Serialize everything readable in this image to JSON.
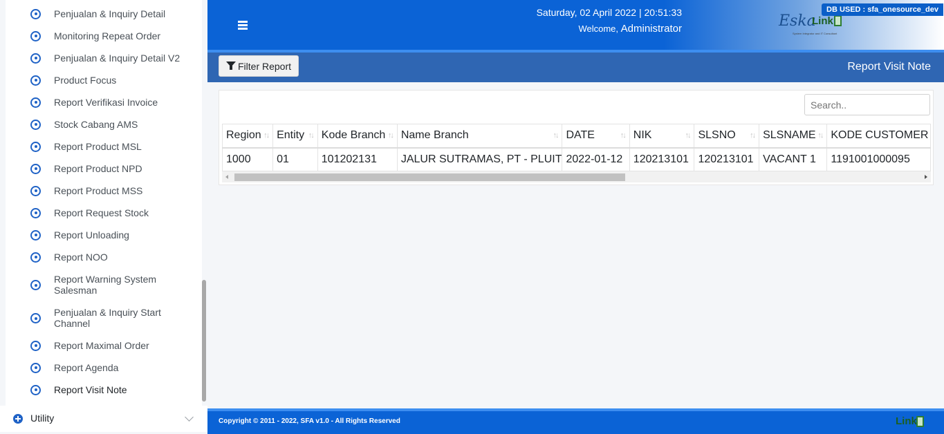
{
  "sidebar": {
    "items": [
      {
        "label": "Penjualan & Inquiry Detail"
      },
      {
        "label": "Monitoring Repeat Order"
      },
      {
        "label": "Penjualan & Inquiry Detail V2"
      },
      {
        "label": "Product Focus"
      },
      {
        "label": "Report Verifikasi Invoice"
      },
      {
        "label": "Stock Cabang AMS"
      },
      {
        "label": "Report Product MSL"
      },
      {
        "label": "Report Product NPD"
      },
      {
        "label": "Report Product MSS"
      },
      {
        "label": "Report Request Stock"
      },
      {
        "label": "Report Unloading"
      },
      {
        "label": "Report NOO"
      },
      {
        "label": "Report Warning System Salesman"
      },
      {
        "label": "Penjualan & Inquiry Start Channel"
      },
      {
        "label": "Report Maximal Order"
      },
      {
        "label": "Report Agenda"
      },
      {
        "label": "Report Visit Note",
        "active": true
      }
    ],
    "utility_label": "Utility"
  },
  "header": {
    "datetime": "Saturday, 02 April 2022 | 20:51:33",
    "welcome_prefix": "Welcome,",
    "username": "Administrator",
    "db_badge": "DB USED : sfa_onesource_dev",
    "logo_eska": "Eska",
    "logo_link": "Link",
    "logo_tagline": "System Integrator and IT Consultant"
  },
  "toolbar": {
    "filter_label": "Filter Report",
    "title": "Report Visit Note"
  },
  "search": {
    "placeholder": "Search.."
  },
  "table": {
    "columns": [
      "Region",
      "Entity",
      "Kode Branch",
      "Name Branch",
      "DATE",
      "NIK",
      "SLSNO",
      "SLSNAME",
      "KODE CUSTOMER"
    ],
    "rows": [
      [
        "1000",
        "01",
        "101202131",
        "JALUR SUTRAMAS, PT - PLUIT",
        "2022-01-12",
        "120213101",
        "120213101",
        "VACANT 1",
        "1191001000095"
      ]
    ]
  },
  "footer": {
    "copyright": "Copyright © 2011 - 2022, SFA v1.0 - All Rights Reserved",
    "logo_link": "Link"
  },
  "colors": {
    "header_blue": "#0b63d6",
    "toolbar_blue": "#2f66b3",
    "icon_blue": "#1f62c6"
  }
}
